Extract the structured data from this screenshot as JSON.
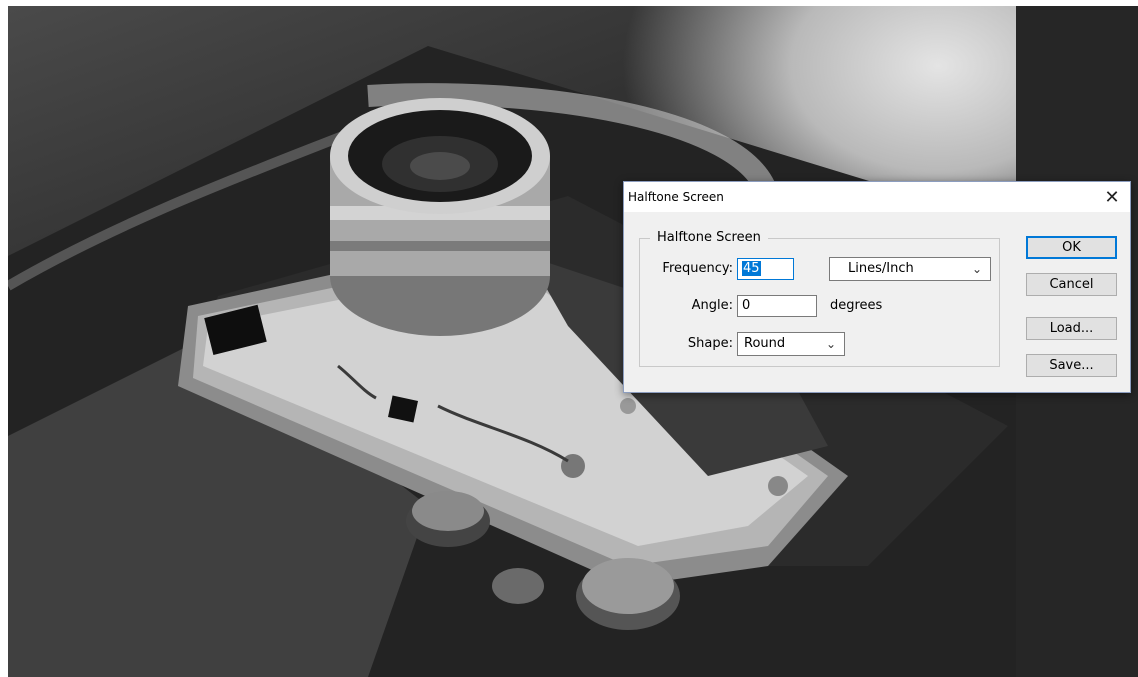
{
  "dialog": {
    "title": "Halftone Screen",
    "group_title": "Halftone Screen",
    "frequency": {
      "label": "Frequency:",
      "value": "45",
      "unit": "Lines/Inch"
    },
    "angle": {
      "label": "Angle:",
      "value": "0",
      "unit": "degrees"
    },
    "shape": {
      "label": "Shape:",
      "value": "Round"
    },
    "buttons": {
      "ok": "OK",
      "cancel": "Cancel",
      "load": "Load...",
      "save": "Save..."
    },
    "close_icon": "✕"
  },
  "icons": {
    "close": "close-icon",
    "dropdown": "chevron-down-icon"
  },
  "colors": {
    "accent": "#0078d7",
    "dialog_bg": "#f0f0f0",
    "workspace_bg": "#282828"
  }
}
